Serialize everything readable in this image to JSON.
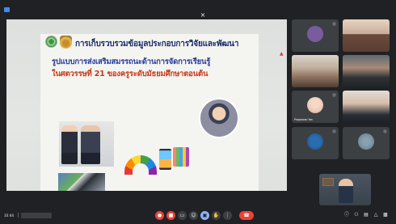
{
  "topbar": {
    "title": "",
    "right_text": ""
  },
  "slide": {
    "title_line1": "การเก็บรวบรวมข้อมูลประกอบการวิจัยและพัฒนา",
    "title_line2": "รูปแบบการส่งเสริมสมรรถนะด้านการจัดการเรียนรู้",
    "title_line3": "ในศตวรรษที่ 21 ของครูระดับมัธยมศึกษาตอนต้น",
    "subtitle_lines": [
      "",
      "",
      ""
    ],
    "presenter_name": "",
    "presenter_role_lines": [
      "",
      ""
    ],
    "caption_lines": [
      "",
      ""
    ],
    "body_lines": [
      "",
      "",
      "",
      ""
    ]
  },
  "participants": [
    {
      "name": "",
      "avatar_color": "#7a5c9e"
    },
    {
      "name": "",
      "avatar_color": "#c9a98f"
    },
    {
      "name": "",
      "avatar_color": "#d8b79b"
    },
    {
      "name": "",
      "avatar_color": "#9a7b6a"
    },
    {
      "name": "Prapaiwan Yan",
      "avatar_color": "#e9c9b8"
    },
    {
      "name": "",
      "avatar_color": "#d2b8a5"
    },
    {
      "name": "",
      "avatar_color": "#2b6cb0"
    },
    {
      "name": "",
      "avatar_color": "#607d8b"
    }
  ],
  "bottombar": {
    "clock": "10:44",
    "meeting_code": ""
  },
  "colors": {
    "background": "#202124",
    "tile": "#3c4043",
    "accent_red": "#ea4335",
    "accent_blue": "#8ab4f8"
  }
}
